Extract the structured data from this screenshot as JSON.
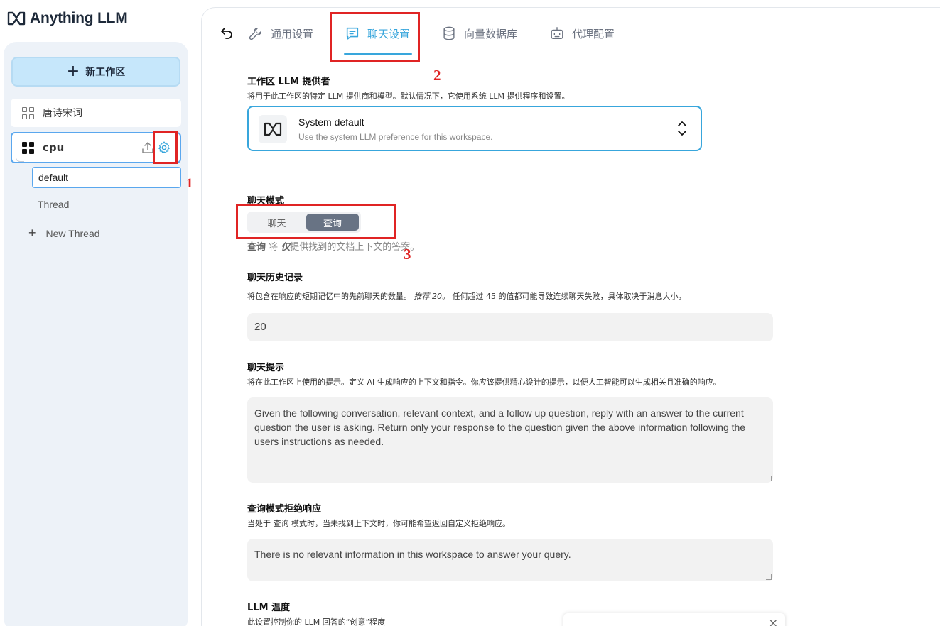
{
  "app": {
    "name": "Anything LLM"
  },
  "sidebar": {
    "new_workspace_label": "新工作区",
    "workspaces": [
      {
        "name": "唐诗宋词"
      },
      {
        "name": "cpu"
      }
    ],
    "thread_input_value": "default",
    "thread_label": "Thread",
    "new_thread_label": "New Thread"
  },
  "tabs": [
    {
      "label": "通用设置",
      "icon": "wrench-icon"
    },
    {
      "label": "聊天设置",
      "icon": "chat-icon",
      "active": true
    },
    {
      "label": "向量数据库",
      "icon": "database-icon"
    },
    {
      "label": "代理配置",
      "icon": "robot-icon"
    }
  ],
  "llm_provider": {
    "title": "工作区 LLM 提供者",
    "description": "将用于此工作区的特定 LLM 提供商和模型。默认情况下，它使用系统 LLM 提供程序和设置。",
    "selected_name": "System default",
    "selected_desc": "Use the system LLM preference for this workspace."
  },
  "chat_mode": {
    "title": "聊天模式",
    "options": [
      "聊天",
      "查询"
    ],
    "selected": "查询",
    "desc_bold": "查询",
    "desc_mid": " 将 ",
    "desc_italic": "仅",
    "desc_rest": "提供找到的文档上下文的答案。"
  },
  "chat_history": {
    "title": "聊天历史记录",
    "description_a": "将包含在响应的短期记忆中的先前聊天的数量。",
    "description_em": "推荐 20。",
    "description_b": "任何超过 45 的值都可能导致连续聊天失败，具体取决于消息大小。",
    "value": "20"
  },
  "chat_prompt": {
    "title": "聊天提示",
    "description": "将在此工作区上使用的提示。定义 AI 生成响应的上下文和指令。你应该提供精心设计的提示，以便人工智能可以生成相关且准确的响应。",
    "value": "Given the following conversation, relevant context, and a follow up question, reply with an answer to the current question the user is asking. Return only your response to the question given the above information following the users instructions as needed."
  },
  "query_refusal": {
    "title": "查询模式拒绝响应",
    "description": "当处于 查询 模式时，当未找到上下文时，你可能希望返回自定义拒绝响应。",
    "value": "There is no relevant information in this workspace to answer your query."
  },
  "llm_temperature": {
    "title": "LLM 温度",
    "description": "此设置控制你的 LLM 回答的“创意”程度"
  },
  "annotations": [
    "1",
    "2",
    "3"
  ],
  "colors": {
    "accent": "#38a6dc",
    "highlight": "#e02424",
    "sidebar_bg": "#edf2f8"
  }
}
